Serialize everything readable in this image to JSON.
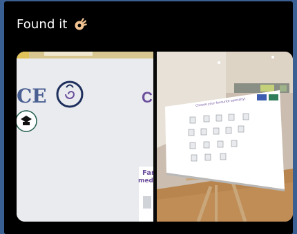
{
  "post": {
    "text": "Found it",
    "emoji": "ok-hand-emoji"
  },
  "media": {
    "left_photo": {
      "sign_text_left": "CE",
      "sign_text_right": "C",
      "partial_text_line1": "Fam",
      "partial_text_line2": "medi"
    },
    "right_photo": {
      "board_title": "Choose your favourite specialty!"
    }
  },
  "colors": {
    "page_background": "#3a5f93",
    "post_background": "#000000",
    "text": "#ffffff",
    "accent_purple": "#6b4e9c",
    "navy": "#1e2f5c"
  }
}
